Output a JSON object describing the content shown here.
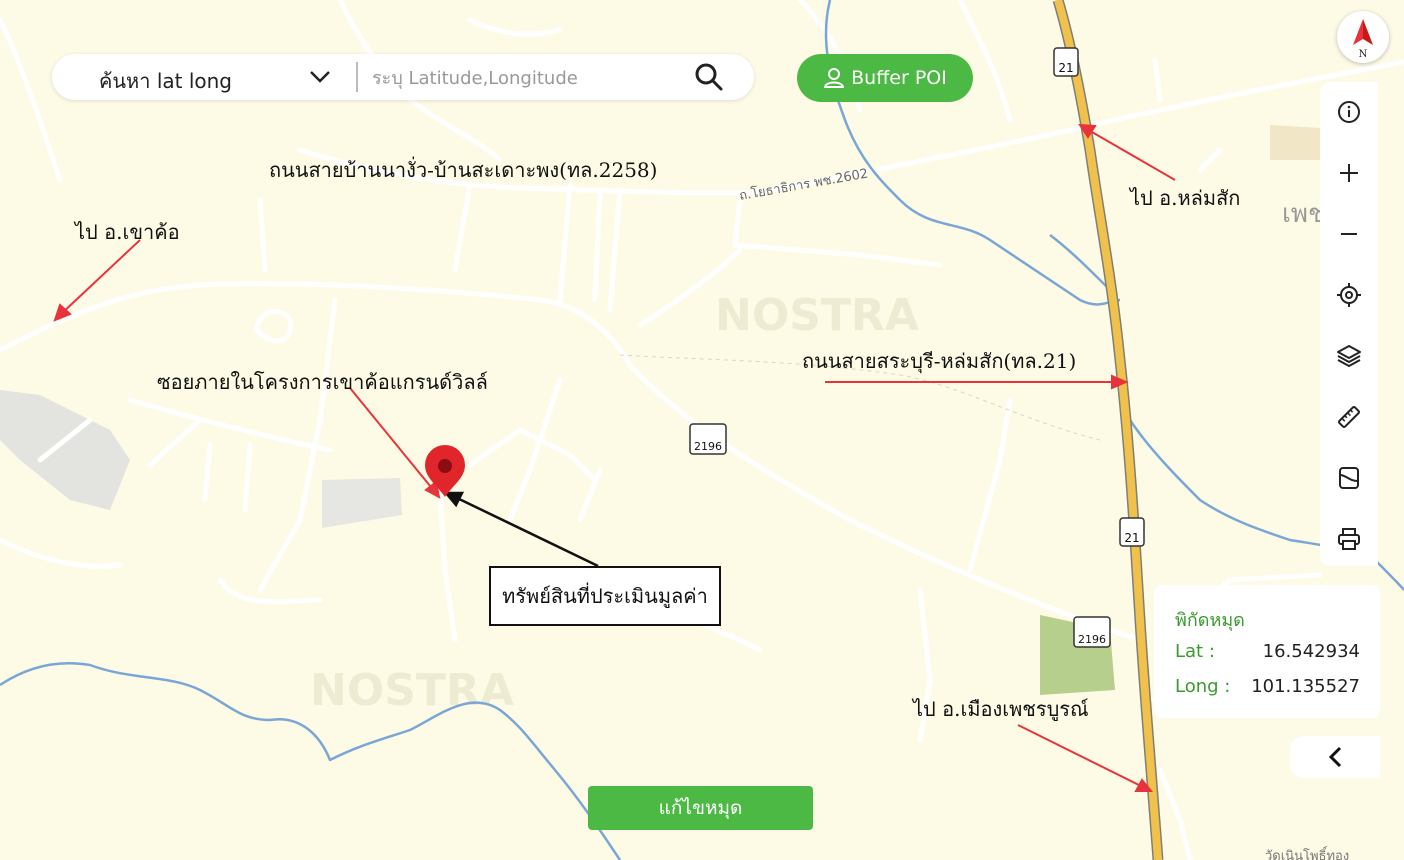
{
  "search": {
    "mode_label": "ค้นหา lat long",
    "placeholder": "ระบุ Latitude,Longitude"
  },
  "buffer_button": {
    "label": "Buffer POI"
  },
  "compass": {
    "label": "N"
  },
  "toolbar": {
    "icons": [
      "info-icon",
      "zoom-in-icon",
      "zoom-out-icon",
      "locate-icon",
      "layers-icon",
      "ruler-icon",
      "map-sheet-icon",
      "print-icon"
    ]
  },
  "coordinates": {
    "title": "พิกัดหมุด",
    "lat_label": "Lat :",
    "lat_value": "16.542934",
    "long_label": "Long :",
    "long_value": "101.135527"
  },
  "edit_button": {
    "label": "แก้ไขหมุด"
  },
  "annotations": {
    "road_2258": "ถนนสายบ้านนางั่ว-บ้านสะเดาะพง(ทล.2258)",
    "to_khao_kho": "ไป อ.เขาค้อ",
    "to_lom_sak": "ไป อ.หล่มสัก",
    "road_21": "ถนนสายสระบุรี-หล่มสัก(ทล.21)",
    "soi": "ซอยภายในโครงการเขาค้อแกรนด์วิลล์",
    "asset": "ทรัพย์สินที่ประเมินมูลค่า",
    "to_mueang": "ไป อ.เมืองเพชรบูรณ์"
  },
  "map_labels": {
    "road_2602": "ถ.โยธาธิการ พช.2602",
    "shield_21": "21",
    "shield_2196": "2196",
    "watermark": "NOSTRA",
    "edge_text": "เพช",
    "bottom_text": "วัดเนินโพธิ์ทอง"
  },
  "colors": {
    "map_bg": "#fdfbe6",
    "accent_green": "#4cb944",
    "highway": "#f0c24b",
    "river": "#7aa6d6",
    "annotation_arrow": "#e8333b",
    "pin": "#e0262b"
  }
}
